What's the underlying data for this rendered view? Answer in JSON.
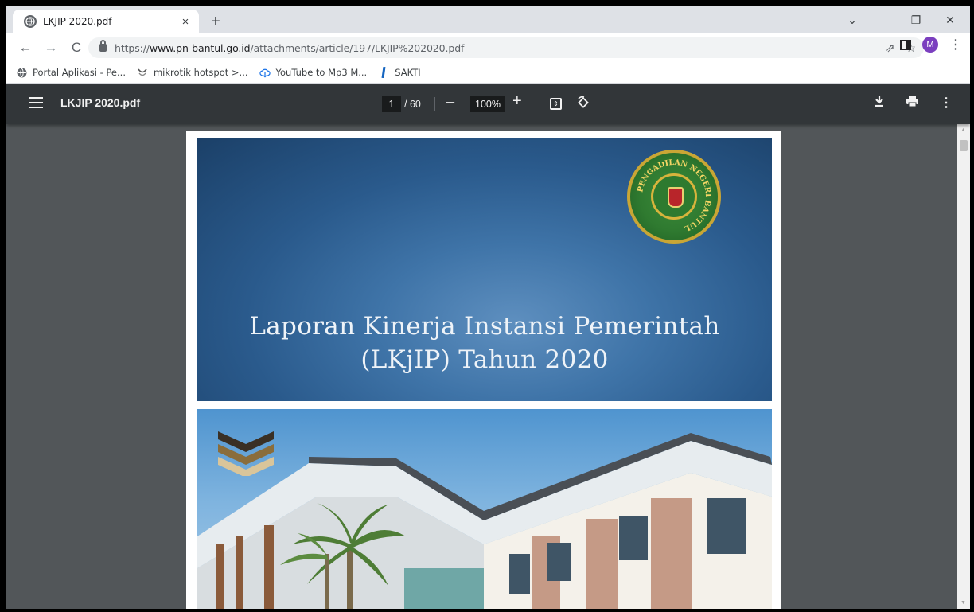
{
  "browser": {
    "tab": {
      "title": "LKJIP 2020.pdf",
      "close": "×"
    },
    "new_tab": "+",
    "window_controls": {
      "dropdown": "⌄",
      "minimize": "–",
      "restore": "❐",
      "close": "✕"
    },
    "nav": {
      "back": "←",
      "forward": "→",
      "reload": "C"
    },
    "url": {
      "scheme": "https://",
      "host": "www.pn-bantul.go.id",
      "path": "/attachments/article/197/LKJIP%202020.pdf"
    },
    "avatar_letter": "M",
    "bookmarks": [
      {
        "label": "Portal Aplikasi - Pe...",
        "icon": "globe-icon"
      },
      {
        "label": "mikrotik hotspot >...",
        "icon": "mikrotik-icon"
      },
      {
        "label": "YouTube to Mp3 M...",
        "icon": "cloud-download-icon"
      },
      {
        "label": "SAKTI",
        "icon": "bookmark-flag-icon"
      }
    ]
  },
  "pdf_viewer": {
    "title": "LKJIP 2020.pdf",
    "current_page": "1",
    "total_pages": "/ 60",
    "zoom": "100%",
    "zoom_out": "–",
    "zoom_in": "+"
  },
  "document": {
    "cover_title_line1": "Laporan Kinerja Instansi Pemerintah",
    "cover_title_line2": "(LKjIP) Tahun 2020",
    "seal_text": "PENGADILAN NEGERI BANTUL"
  }
}
